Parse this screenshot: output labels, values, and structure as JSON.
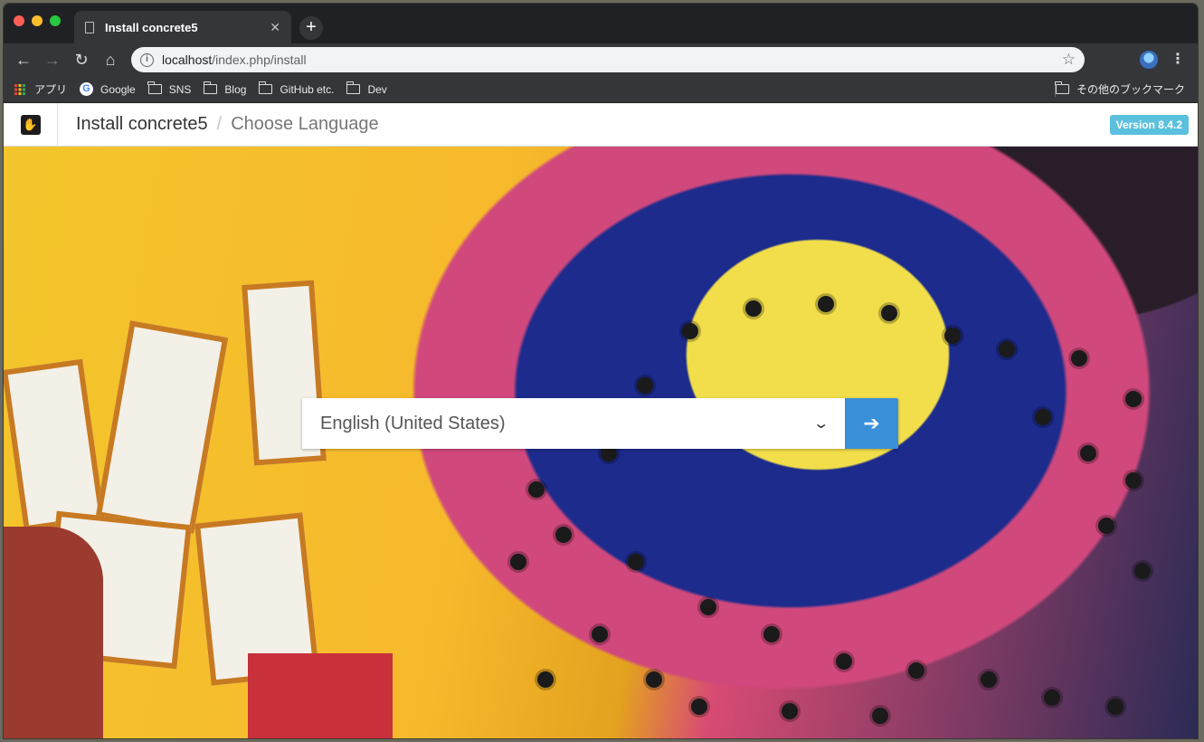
{
  "browser": {
    "tab_title": "Install concrete5",
    "url_host": "localhost",
    "url_path": "/index.php/install",
    "bookmarks": [
      {
        "label": "アプリ",
        "icon": "apps-grid-icon"
      },
      {
        "label": "Google",
        "icon": "google-icon"
      },
      {
        "label": "SNS",
        "icon": "folder-icon"
      },
      {
        "label": "Blog",
        "icon": "folder-icon"
      },
      {
        "label": "GitHub etc.",
        "icon": "folder-icon"
      },
      {
        "label": "Dev",
        "icon": "folder-icon"
      }
    ],
    "other_bookmarks": "その他のブックマーク"
  },
  "header": {
    "title": "Install concrete5",
    "separator": "/",
    "subtitle": "Choose Language",
    "version_badge": "Version 8.4.2"
  },
  "language_form": {
    "selected": "English (United States)"
  },
  "colors": {
    "accent": "#3a8fd9",
    "badge": "#5bc0de"
  }
}
